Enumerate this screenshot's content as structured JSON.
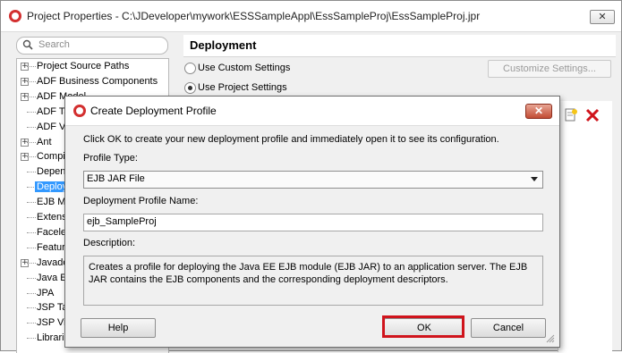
{
  "window": {
    "title": "Project Properties - C:\\JDeveloper\\mywork\\ESSSampleAppl\\EssSampleProj\\EssSampleProj.jpr",
    "close_label": "✕"
  },
  "search": {
    "placeholder": "Search"
  },
  "tree": {
    "items": [
      {
        "label": "Project Source Paths",
        "expandable": true
      },
      {
        "label": "ADF Business Components",
        "expandable": true
      },
      {
        "label": "ADF Model",
        "expandable": true
      },
      {
        "label": "ADF Ta",
        "expandable": false
      },
      {
        "label": "ADF Vi",
        "expandable": false
      },
      {
        "label": "Ant",
        "expandable": true
      },
      {
        "label": "Compil",
        "expandable": true
      },
      {
        "label": "Depen",
        "expandable": false
      },
      {
        "label": "Deploy",
        "expandable": false,
        "selected": true
      },
      {
        "label": "EJB Mo",
        "expandable": false
      },
      {
        "label": "Extens",
        "expandable": false
      },
      {
        "label": "Facele",
        "expandable": false
      },
      {
        "label": "Featur",
        "expandable": false
      },
      {
        "label": "Javado",
        "expandable": true
      },
      {
        "label": "Java E",
        "expandable": false
      },
      {
        "label": "JPA",
        "expandable": false
      },
      {
        "label": "JSP Ta",
        "expandable": false
      },
      {
        "label": "JSP Vis",
        "expandable": false
      },
      {
        "label": "Librari",
        "expandable": false
      }
    ]
  },
  "deployment": {
    "title": "Deployment",
    "use_custom": "Use Custom Settings",
    "use_project": "Use Project Settings",
    "customize_button": "Customize Settings..."
  },
  "dialog": {
    "title": "Create Deployment Profile",
    "close_label": "✕",
    "intro": "Click OK to create your new deployment profile and immediately open it to see its configuration.",
    "profile_type_label": "Profile Type:",
    "profile_type_value": "EJB JAR File",
    "name_label": "Deployment Profile Name:",
    "name_value": "ejb_SampleProj",
    "description_label": "Description:",
    "description_text": "Creates a profile for deploying the Java EE EJB module (EJB JAR) to an application server. The EJB JAR contains the EJB components and the corresponding deployment descriptors.",
    "help_button": "Help",
    "ok_button": "OK",
    "cancel_button": "Cancel",
    "highlight_color": "#d0141c"
  }
}
